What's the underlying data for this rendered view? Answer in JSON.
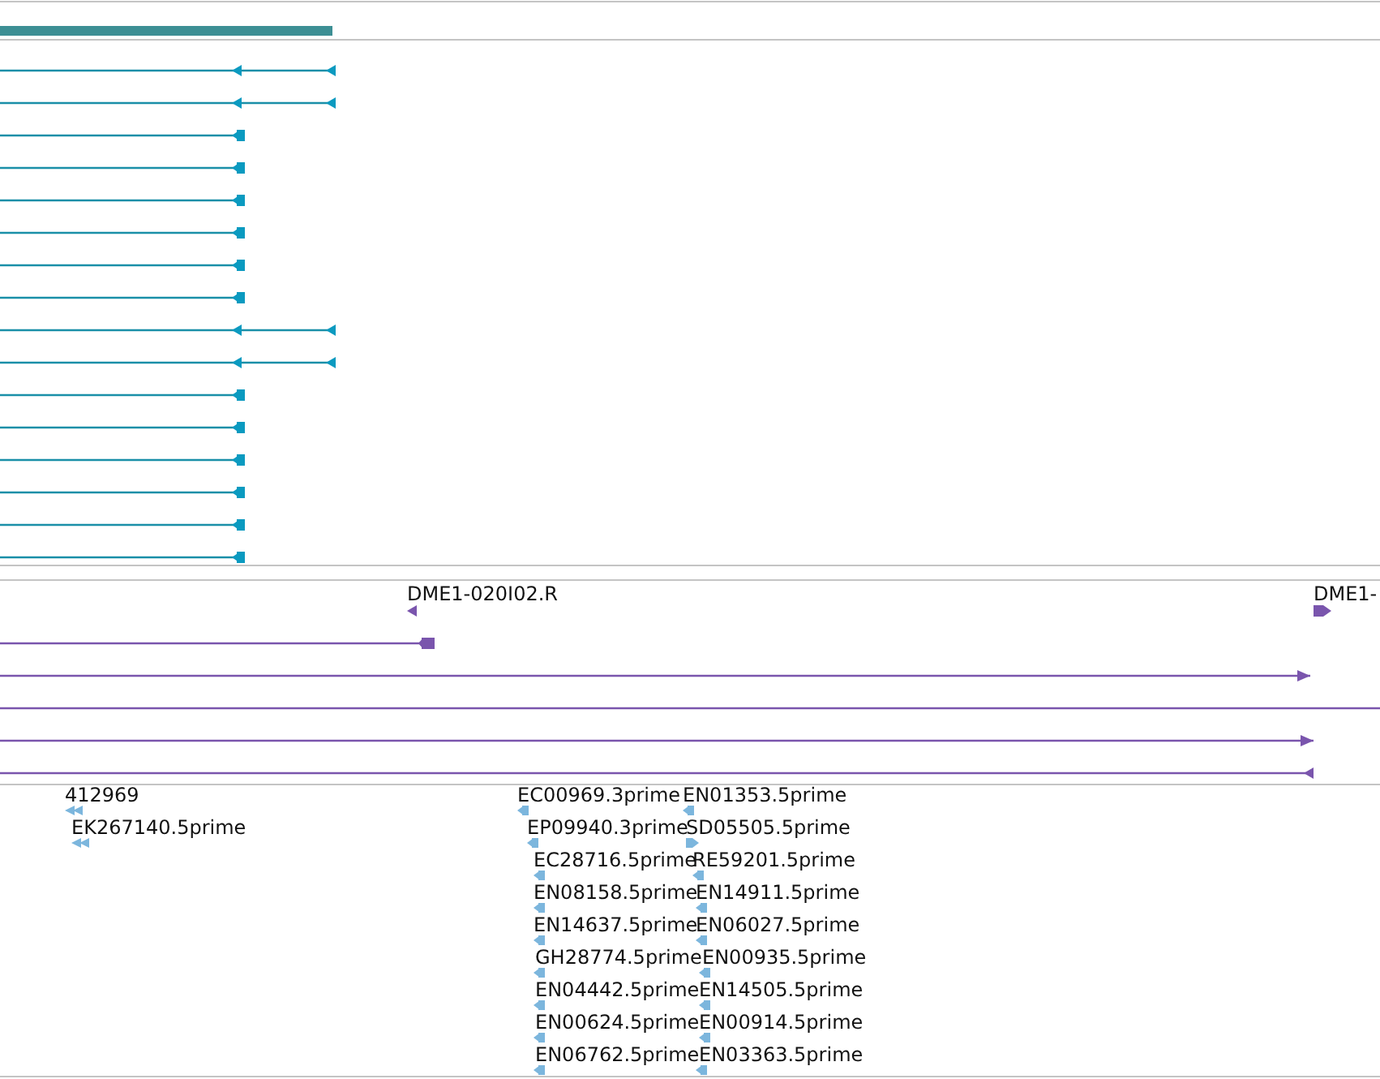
{
  "gene_track": {
    "features": [
      {
        "kind": "gene"
      }
    ]
  },
  "transcript_track": {
    "transcripts": [
      {
        "kind": "two-exon"
      },
      {
        "kind": "two-exon"
      },
      {
        "kind": "one-exon"
      },
      {
        "kind": "one-exon"
      },
      {
        "kind": "one-exon"
      },
      {
        "kind": "one-exon"
      },
      {
        "kind": "one-exon"
      },
      {
        "kind": "one-exon"
      },
      {
        "kind": "two-exon"
      },
      {
        "kind": "two-exon"
      },
      {
        "kind": "one-exon"
      },
      {
        "kind": "one-exon"
      },
      {
        "kind": "one-exon"
      },
      {
        "kind": "one-exon"
      },
      {
        "kind": "one-exon"
      },
      {
        "kind": "one-exon"
      }
    ]
  },
  "clone_track": {
    "labels": [
      {
        "text": "DME1-020I02.R",
        "reverse": true
      },
      {
        "text": "DME1-",
        "reverse": false
      }
    ],
    "reads": [
      {
        "kind": "cap",
        "reverse": true
      },
      {
        "kind": "arrow",
        "reverse": false
      },
      {
        "kind": "open"
      },
      {
        "kind": "arrow",
        "reverse": false
      },
      {
        "kind": "arrow",
        "reverse": true
      }
    ]
  },
  "est_track": {
    "columns": [
      {
        "features": [
          {
            "label": "412969",
            "reverse": true
          },
          {
            "label": "EK267140.5prime",
            "reverse": true
          }
        ]
      },
      {
        "features": [
          {
            "label": "EC00969.3prime",
            "reverse": true
          },
          {
            "label": "EP09940.3prime",
            "reverse": true
          },
          {
            "label": "EC28716.5prime",
            "reverse": true
          },
          {
            "label": "EN08158.5prime",
            "reverse": true
          },
          {
            "label": "EN14637.5prime",
            "reverse": true
          },
          {
            "label": "GH28774.5prime",
            "reverse": true
          },
          {
            "label": "EN04442.5prime",
            "reverse": true
          },
          {
            "label": "EN00624.5prime",
            "reverse": true
          },
          {
            "label": "EN06762.5prime",
            "reverse": true
          }
        ]
      },
      {
        "features": [
          {
            "label": "EN01353.5prime",
            "reverse": true
          },
          {
            "label": "SD05505.5prime",
            "reverse": false
          },
          {
            "label": "RE59201.5prime",
            "reverse": true
          },
          {
            "label": "EN14911.5prime",
            "reverse": true
          },
          {
            "label": "EN06027.5prime",
            "reverse": true
          },
          {
            "label": "EN00935.5prime",
            "reverse": true
          },
          {
            "label": "EN14505.5prime",
            "reverse": true
          },
          {
            "label": "EN00914.5prime",
            "reverse": true
          },
          {
            "label": "EN03363.5prime",
            "reverse": true
          }
        ]
      }
    ]
  }
}
